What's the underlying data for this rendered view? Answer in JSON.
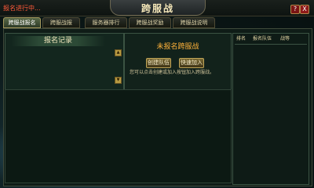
{
  "window": {
    "status_text": "报名进行中...",
    "title": "跨服战",
    "help_label": "?",
    "close_label": "X"
  },
  "tabs": [
    {
      "label": "跨服战报名",
      "active": true
    },
    {
      "label": "跨服战报",
      "active": false
    },
    {
      "label": "服务器排行",
      "active": false
    },
    {
      "label": "跨服战奖励",
      "active": false
    },
    {
      "label": "跨服战说明",
      "active": false
    }
  ],
  "signup": {
    "heading": "报名记录",
    "scroll_up": "▲",
    "scroll_down": "▼"
  },
  "center": {
    "status_title": "未报名跨服战",
    "create_button": "创建队伍",
    "join_button": "快速加入",
    "description": "您可以点击创建或加入按钮加入跨服战。"
  },
  "ranking": {
    "columns": [
      "排名",
      "报名队伍",
      "战等"
    ]
  },
  "colors": {
    "status_red": "#ff5a3a",
    "highlight_orange": "#ffb23a",
    "gold_button": "#7a6a34"
  }
}
